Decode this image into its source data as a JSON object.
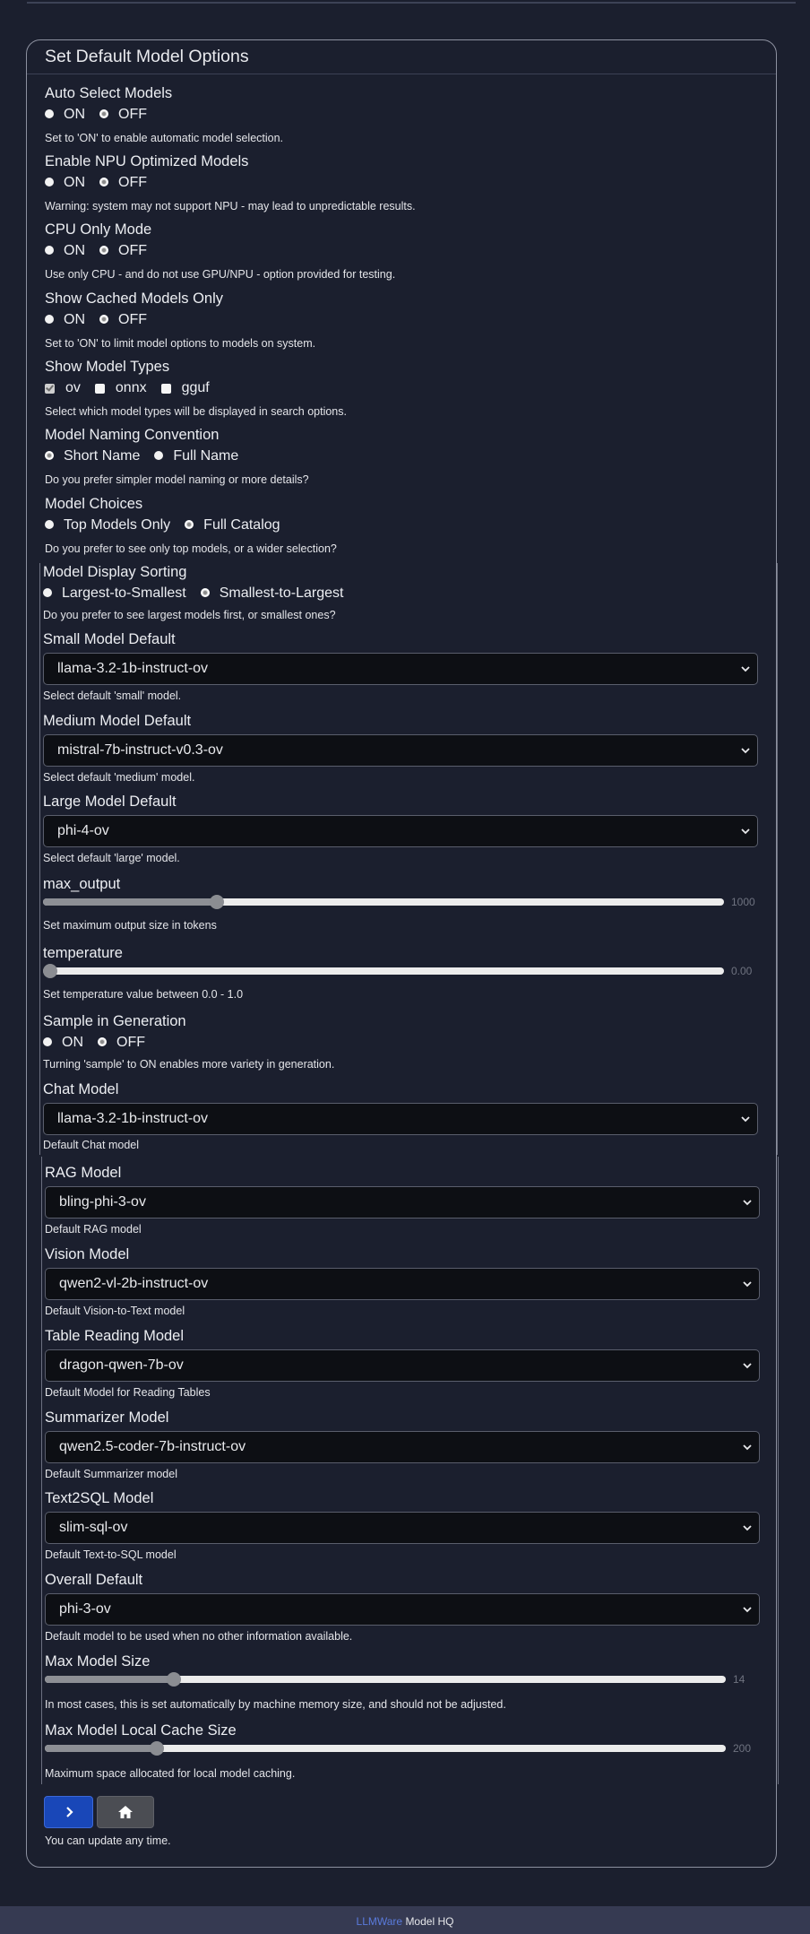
{
  "panel": {
    "title": "Set Default Model Options"
  },
  "auto_select": {
    "label": "Auto Select Models",
    "on": "ON",
    "off": "OFF",
    "selected": "OFF",
    "help": "Set to 'ON' to enable automatic model selection."
  },
  "npu": {
    "label": "Enable NPU Optimized Models",
    "on": "ON",
    "off": "OFF",
    "selected": "OFF",
    "help": "Warning: system may not support NPU - may lead to unpredictable results."
  },
  "cpu_only": {
    "label": "CPU Only Mode",
    "on": "ON",
    "off": "OFF",
    "selected": "OFF",
    "help": "Use only CPU - and do not use GPU/NPU - option provided for testing."
  },
  "cached_only": {
    "label": "Show Cached Models Only",
    "on": "ON",
    "off": "OFF",
    "selected": "OFF",
    "help": "Set to 'ON' to limit model options to models on system."
  },
  "model_types": {
    "label": "Show Model Types",
    "options": [
      {
        "label": "ov",
        "checked": true
      },
      {
        "label": "onnx",
        "checked": false
      },
      {
        "label": "gguf",
        "checked": false
      }
    ],
    "help": "Select which model types will be displayed in search options."
  },
  "naming": {
    "label": "Model Naming Convention",
    "opt1": "Short Name",
    "opt2": "Full Name",
    "selected": "Short Name",
    "help": "Do you prefer simpler model naming or more details?"
  },
  "choices": {
    "label": "Model Choices",
    "opt1": "Top Models Only",
    "opt2": "Full Catalog",
    "selected": "Full Catalog",
    "help": "Do you prefer to see only top models, or a wider selection?"
  },
  "sorting": {
    "label": "Model Display Sorting",
    "opt1": "Largest-to-Smallest",
    "opt2": "Smallest-to-Largest",
    "selected": "Smallest-to-Largest",
    "help": "Do you prefer to see largest models first, or smallest ones?"
  },
  "small_model": {
    "label": "Small Model Default",
    "value": "llama-3.2-1b-instruct-ov",
    "help": "Select default 'small' model."
  },
  "medium_model": {
    "label": "Medium Model Default",
    "value": "mistral-7b-instruct-v0.3-ov",
    "help": "Select default 'medium' model."
  },
  "large_model": {
    "label": "Large Model Default",
    "value": "phi-4-ov",
    "help": "Select default 'large' model."
  },
  "max_output": {
    "label": "max_output",
    "value": "1000",
    "fraction": 0.255,
    "help": "Set maximum output size in tokens"
  },
  "temperature": {
    "label": "temperature",
    "value": "0.00",
    "fraction": 0.0,
    "help": "Set temperature value between 0.0 - 1.0"
  },
  "sample": {
    "label": "Sample in Generation",
    "on": "ON",
    "off": "OFF",
    "selected": "OFF",
    "help": "Turning 'sample' to ON enables more variety in generation."
  },
  "chat_model": {
    "label": "Chat Model",
    "value": "llama-3.2-1b-instruct-ov",
    "help": "Default Chat model"
  },
  "rag_model": {
    "label": "RAG Model",
    "value": "bling-phi-3-ov",
    "help": "Default RAG model"
  },
  "vision_model": {
    "label": "Vision Model",
    "value": "qwen2-vl-2b-instruct-ov",
    "help": "Default Vision-to-Text model"
  },
  "table_model": {
    "label": "Table Reading Model",
    "value": "dragon-qwen-7b-ov",
    "help": "Default Model for Reading Tables"
  },
  "summarizer_model": {
    "label": "Summarizer Model",
    "value": "qwen2.5-coder-7b-instruct-ov",
    "help": "Default Summarizer model"
  },
  "text2sql_model": {
    "label": "Text2SQL Model",
    "value": "slim-sql-ov",
    "help": "Default Text-to-SQL model"
  },
  "overall_default": {
    "label": "Overall Default",
    "value": "phi-3-ov",
    "help": "Default model to be used when no other information available."
  },
  "max_model_size": {
    "label": "Max Model Size",
    "value": "14",
    "fraction": 0.19,
    "help": "In most cases, this is set automatically by machine memory size, and should not be adjusted."
  },
  "max_cache": {
    "label": "Max Model Local Cache Size",
    "value": "200",
    "fraction": 0.165,
    "help": "Maximum space allocated for local model caching."
  },
  "actions": {
    "next_icon": "chevron-right-icon",
    "home_icon": "home-icon",
    "note": "You can update any time."
  },
  "footer": {
    "brand_part1": "LLMWare",
    "brand_part2": "Model HQ"
  }
}
